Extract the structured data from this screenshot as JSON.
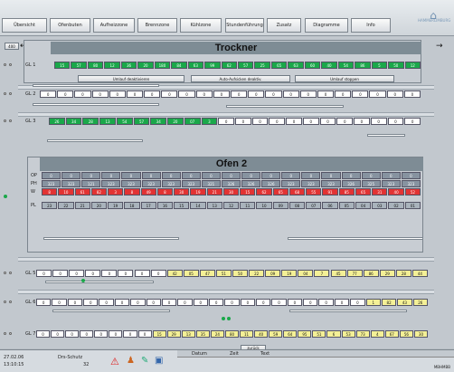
{
  "nav": [
    "Übersicht",
    "Ofenbuten",
    "Aufheizzone",
    "Brennzone",
    "Kühlzone",
    "Stundenführung",
    "Zusatz",
    "Diagramme",
    "Info"
  ],
  "logo": "HAMMERLIMBURG",
  "left_btn": "400",
  "trockner": {
    "title": "Trockner",
    "rows": [
      {
        "label": "GL 1",
        "values": [
          "15",
          "57",
          "80",
          "12",
          "36",
          "20",
          "180",
          "84",
          "63",
          "99",
          "62",
          "57",
          "25",
          "65",
          "63",
          "60",
          "40",
          "54",
          "86",
          "5",
          "50",
          "12"
        ]
      },
      {
        "label": "GL 2",
        "values": [
          "0",
          "0",
          "0",
          "0",
          "0",
          "0",
          "0",
          "0",
          "0",
          "0",
          "0",
          "0",
          "0",
          "0",
          "0",
          "0",
          "0",
          "0",
          "0",
          "0",
          "0",
          "0"
        ]
      },
      {
        "label": "GL 3",
        "values": [
          "26",
          "34",
          "28",
          "13",
          "54",
          "57",
          "34",
          "20",
          "07",
          "3",
          "0",
          "0",
          "0",
          "0",
          "0",
          "0",
          "0",
          "0",
          "0",
          "0",
          "0",
          "0"
        ]
      }
    ],
    "buttons": [
      "Umlauf deaktivieren",
      "Auto-Aufsicken deaktiv.",
      "Umlauf stoppen"
    ]
  },
  "ofen": {
    "title": "Ofen 2",
    "labels": [
      "OP",
      "PH",
      "W",
      "PL"
    ],
    "op": [
      "0",
      "0",
      "0",
      "0",
      "0",
      "0",
      "0",
      "0",
      "0",
      "0",
      "0",
      "0",
      "0",
      "0",
      "0",
      "0",
      "0",
      "0",
      "0"
    ],
    "ph": [
      "323",
      "323",
      "121",
      "323",
      "323",
      "323",
      "323",
      "323",
      "321",
      "326",
      "326",
      "326",
      "323",
      "323",
      "323",
      "326",
      "325",
      "323",
      "323"
    ],
    "w": [
      "8",
      "10",
      "61",
      "82",
      "3",
      "8",
      "49",
      "8",
      "30",
      "19",
      "21",
      "30",
      "15",
      "62",
      "65",
      "68",
      "55",
      "91",
      "85",
      "65",
      "31",
      "40",
      "52"
    ],
    "pl": [
      "23",
      "22",
      "21",
      "20",
      "19",
      "18",
      "17",
      "16",
      "15",
      "14",
      "13",
      "12",
      "11",
      "10",
      "09",
      "08",
      "07",
      "06",
      "05",
      "04",
      "03",
      "02",
      "01"
    ]
  },
  "gl5": {
    "label": "GL 5",
    "values": [
      "0",
      "0",
      "0",
      "0",
      "0",
      "0",
      "0",
      "0",
      "42",
      "05",
      "47",
      "51",
      "50",
      "22",
      "09",
      "19",
      "04",
      "7",
      "45",
      "77",
      "86",
      "29",
      "28",
      "44"
    ]
  },
  "gl6": {
    "label": "GL 6",
    "values": [
      "0",
      "0",
      "0",
      "0",
      "0",
      "0",
      "0",
      "0",
      "0",
      "0",
      "0",
      "0",
      "0",
      "0",
      "0",
      "0",
      "0",
      "0",
      "0",
      "0",
      "0",
      "1",
      "82",
      "43",
      "26"
    ]
  },
  "gl7": {
    "label": "GL 7",
    "values": [
      "0",
      "0",
      "0",
      "0",
      "0",
      "0",
      "0",
      "0",
      "15",
      "29",
      "13",
      "35",
      "24",
      "80",
      "11",
      "40",
      "59",
      "64",
      "95",
      "51",
      "6",
      "53",
      "73",
      "4",
      "67",
      "56",
      "30"
    ]
  },
  "side_code": "0.0",
  "zurueck": "zurück",
  "status": {
    "date": "27.02.06",
    "time": "13:10:15",
    "shift_label": "Drs-Schutz",
    "shift_value": "32",
    "columns": [
      "Datum",
      "Zeit",
      "Text"
    ],
    "corner": "MBHMBB"
  },
  "chart_data": {
    "type": "table"
  }
}
